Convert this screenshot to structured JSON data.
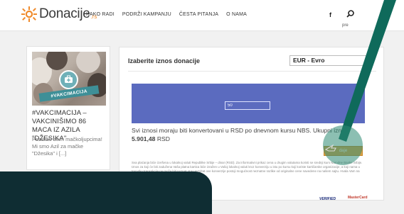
{
  "header": {
    "logo_text": "Donacije",
    "logo_tld": ".rs",
    "nav": [
      "KAKO RADI",
      "PODRŽI KAMPANJU",
      "ČESTA PITANJA",
      "O NAMA"
    ],
    "facebook": "f",
    "profile_label": "pre"
  },
  "campaign_card": {
    "image_tag": "#VAKCIMACIJA",
    "title": "#VAKCIMACIJA – VAKCINIŠIMO 86 MACA IZ AZILA \"DŽESIKA\"",
    "description": "Pozdrav svim mačkoljupcima! Mi smo Azil za mačke \"Džesika\" i [...]"
  },
  "donation": {
    "title": "Izaberite iznos donacije",
    "currency_selected": "EUR - Evro",
    "amount_value": "50",
    "info_line": "Svi iznosi moraju biti konvertovani u RSD po dnevnom kursu NBS. Ukupni iznos",
    "converted_amount": "5.901,48",
    "converted_currency": "RSD",
    "pay_button": "daje",
    "fine_print": "Sva plaćanja biće izvršena u lokalnoj valuti Republike Srbije – dinar (RSD). Za informativni prikaz cena u drugim valutama koristi se srednji kurs Narodne Banke Srbije. Iznos za koji će biti zadužena Vaša platna kartica biće izražen u Vašoj lokalnoj valuti kroz konverziju u istu po kursu koji koriste kartičarske organizacije, a koji nama u trenutku transakcije ne može biti poznat. Kao rezultat ove konverzije postoji mogućnost neznatne razlike od originalne cene navedene na našem sajtu. Hvala Vam na razumevanju."
  },
  "payment_logos": {
    "visa": "VERIFIED",
    "mastercard": "MasterCard"
  },
  "colors": {
    "accent_orange": "#f08b2c",
    "amount_box": "#5b6bbf",
    "pointer_teal": "#0f6a5b",
    "dark_footer": "#0f2d33"
  }
}
